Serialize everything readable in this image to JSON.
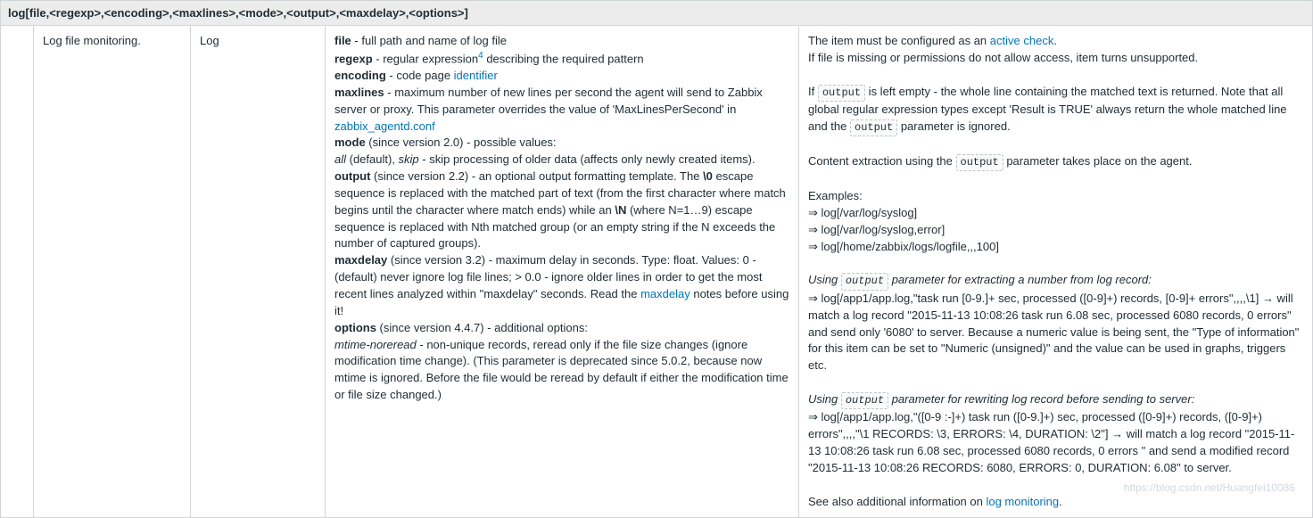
{
  "header": "log[file,<regexp>,<encoding>,<maxlines>,<mode>,<output>,<maxdelay>,<options>]",
  "col1": "Log file monitoring.",
  "col2": "Log",
  "params": {
    "file_b": "file",
    "file_t": " - full path and name of log file",
    "regexp_b": "regexp",
    "regexp_t1": " - regular expression",
    "regexp_sup": "4",
    "regexp_t2": " describing the required pattern",
    "encoding_b": "encoding",
    "encoding_t1": " - code page ",
    "encoding_link": "identifier",
    "maxlines_b": "maxlines",
    "maxlines_t1": " - maximum number of new lines per second the agent will send to Zabbix server or proxy. This parameter overrides the value of 'MaxLinesPerSecond' in ",
    "maxlines_link": "zabbix_agentd.conf",
    "mode_b": "mode",
    "mode_t1": " (since version 2.0) - possible values:",
    "mode_i1": "all",
    "mode_t2": " (default), ",
    "mode_i2": "skip",
    "mode_t3": " - skip processing of older data (affects only newly created items).",
    "output_b": "output",
    "output_t1": " (since version 2.2) - an optional output formatting template. The ",
    "output_bs1": "\\0",
    "output_t2": " escape sequence is replaced with the matched part of text (from the first character where match begins until the character where match ends) while an ",
    "output_bs2": "\\N",
    "output_t3": " (where N=1…9) escape sequence is replaced with Nth matched group (or an empty string if the N exceeds the number of captured groups).",
    "maxdelay_b": "maxdelay",
    "maxdelay_t1": " (since version 3.2) - maximum delay in seconds. Type: float. Values: 0 - (default) never ignore log file lines; > 0.0 - ignore older lines in order to get the most recent lines analyzed within \"maxdelay\" seconds. Read the ",
    "maxdelay_link": "maxdelay",
    "maxdelay_t2": " notes before using it!",
    "options_b": "options",
    "options_t1": " (since version 4.4.7) - additional options:",
    "options_i": "mtime-noreread",
    "options_t2": " - non-unique records, reread only if the file size changes (ignore modification time change). (This parameter is deprecated since 5.0.2, because now mtime is ignored. Before the file would be reread by default if either the modification time or file size changed.)"
  },
  "notes": {
    "l1a": "The item must be configured as an ",
    "l1_link": "active check",
    "l1b": ".",
    "l2": "If file is missing or permissions do not allow access, item turns unsupported.",
    "l3a": "If ",
    "l3_code": "output",
    "l3b": " is left empty - the whole line containing the matched text is returned. Note that all global regular expression types except 'Result is TRUE' always return the whole matched line and the ",
    "l3_code2": "output",
    "l3c": " parameter is ignored.",
    "l4a": "Content extraction using the ",
    "l4_code": "output",
    "l4b": " parameter takes place on the agent.",
    "ex_h": "Examples:",
    "ex1": "⇒ log[/var/log/syslog]",
    "ex2": "⇒ log[/var/log/syslog,error]",
    "ex3": "⇒ log[/home/zabbix/logs/logfile,,,100]",
    "u1a": "Using ",
    "u1_code": "output",
    "u1b": " parameter for extracting a number from log record:",
    "u1_ex": "⇒ log[/app1/app.log,\"task run [0-9.]+ sec, processed ([0-9]+) records, [0-9]+ errors\",,,,\\1] → will match a log record \"2015-11-13 10:08:26 task run 6.08 sec, processed 6080 records, 0 errors\" and send only '6080' to server. Because a numeric value is being sent, the \"Type of information\" for this item can be set to \"Numeric (unsigned)\" and the value can be used in graphs, triggers etc.",
    "u2a": "Using ",
    "u2_code": "output",
    "u2b": " parameter for rewriting log record before sending to server:",
    "u2_ex": "⇒ log[/app1/app.log,\"([0-9 :-]+) task run ([0-9.]+) sec, processed ([0-9]+) records, ([0-9]+) errors\",,,,\"\\1 RECORDS: \\3, ERRORS: \\4, DURATION: \\2\"] → will match a log record \"2015-11-13 10:08:26 task run 6.08 sec, processed 6080 records, 0 errors \" and send a modified record \"2015-11-13 10:08:26 RECORDS: 6080, ERRORS: 0, DURATION: 6.08\" to server.",
    "see_a": "See also additional information on ",
    "see_link": "log monitoring",
    "see_b": "."
  },
  "watermark": "https://blog.csdn.net/Huangfei10086"
}
